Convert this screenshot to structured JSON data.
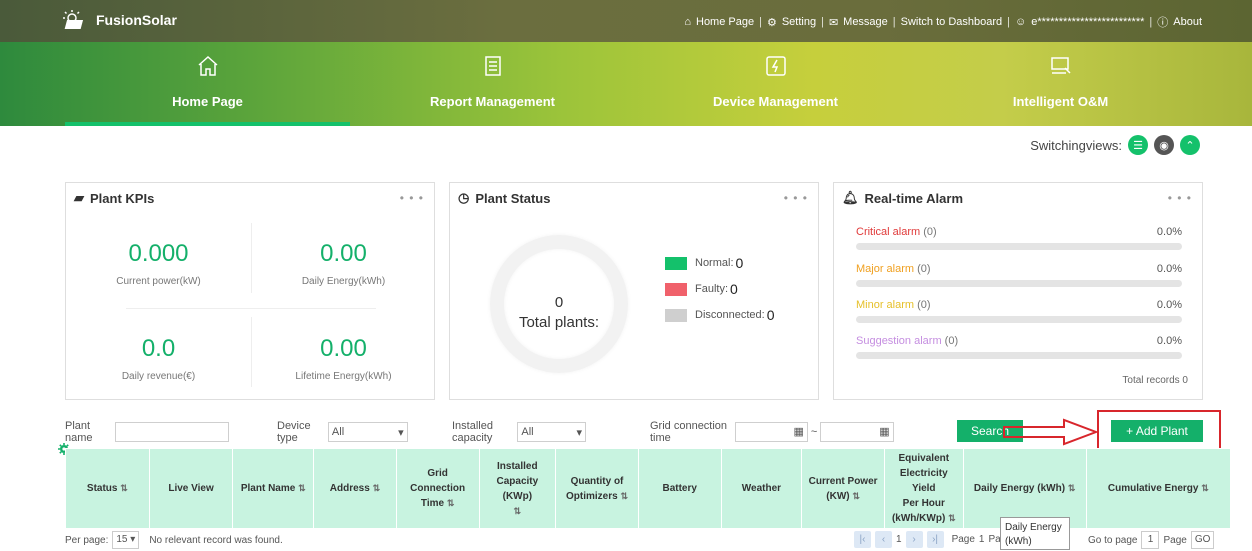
{
  "app": {
    "name": "FusionSolar"
  },
  "toplinks": {
    "home": "Home Page",
    "setting": "Setting",
    "message": "Message",
    "dashboard": "Switch to Dashboard",
    "user": "e*************************",
    "about": "About"
  },
  "nav": [
    {
      "label": "Home Page",
      "icon": "home-icon",
      "active": true
    },
    {
      "label": "Report Management",
      "icon": "report-icon",
      "active": false
    },
    {
      "label": "Device Management",
      "icon": "device-icon",
      "active": false
    },
    {
      "label": "Intelligent O&M",
      "icon": "om-icon",
      "active": false
    }
  ],
  "switching": {
    "label": "Switchingviews:"
  },
  "kpis": {
    "title": "Plant KPIs",
    "current_power": {
      "value": "0.000",
      "label": "Current power(kW)"
    },
    "daily_energy": {
      "value": "0.00",
      "label": "Daily Energy(kWh)"
    },
    "daily_revenue": {
      "value": "0.0",
      "label": "Daily revenue(€)"
    },
    "lifetime_energy": {
      "value": "0.00",
      "label": "Lifetime Energy(kWh)"
    }
  },
  "status": {
    "title": "Plant Status",
    "total_value": "0",
    "total_label": "Total plants:",
    "normal_label": "Normal:",
    "normal_value": "0",
    "faulty_label": "Faulty:",
    "faulty_value": "0",
    "disconnected_label": "Disconnected:",
    "disconnected_value": "0",
    "colors": {
      "normal": "#14c16b",
      "faulty": "#f0616b",
      "disconnected": "#cfcfcf"
    }
  },
  "alarm": {
    "title": "Real-time Alarm",
    "critical": {
      "label": "Critical alarm",
      "count": "(0)",
      "pct": "0.0%",
      "color": "#e03a3a"
    },
    "major": {
      "label": "Major alarm",
      "count": "(0)",
      "pct": "0.0%",
      "color": "#f0a020"
    },
    "minor": {
      "label": "Minor alarm",
      "count": "(0)",
      "pct": "0.0%",
      "color": "#e6c02a"
    },
    "suggestion": {
      "label": "Suggestion alarm",
      "count": "(0)",
      "pct": "0.0%",
      "color": "#c58ee0"
    },
    "total": "Total records 0"
  },
  "filters": {
    "plant_name": "Plant name",
    "device_type": "Device type",
    "device_type_value": "All",
    "installed_capacity": "Installed capacity",
    "installed_capacity_value": "All",
    "grid_time": "Grid connection time",
    "tilde": "~",
    "search": "Search",
    "add_plant": "+ Add Plant"
  },
  "table": {
    "headers": {
      "status": "Status",
      "live_view": "Live View",
      "plant_name": "Plant Name",
      "address": "Address",
      "grid_time_1": "Grid Connection",
      "grid_time_2": "Time",
      "capacity_1": "Installed",
      "capacity_2": "Capacity (KWp)",
      "optimizers_1": "Quantity of",
      "optimizers_2": "Optimizers",
      "battery": "Battery",
      "weather": "Weather",
      "current_power_1": "Current Power",
      "current_power_2": "(KW)",
      "eq_1": "Equivalent",
      "eq_2": "Electricity Yield",
      "eq_3": "Per Hour",
      "eq_4": "(kWh/KWp)",
      "daily_energy": "Daily Energy (kWh)",
      "cumulative": "Cumulative Energy"
    }
  },
  "footer": {
    "per_page": "Per page:",
    "per_page_value": "15",
    "no_record": "No relevant record was found.",
    "page_num": "1",
    "page_label": "Page",
    "page_of": "1",
    "page_trunc": "Page",
    "goto": "Go to page",
    "goto_value": "1",
    "page2": "Page",
    "go": "GO"
  },
  "tooltip": {
    "line1": "Daily Energy",
    "line2": "(kWh)"
  }
}
